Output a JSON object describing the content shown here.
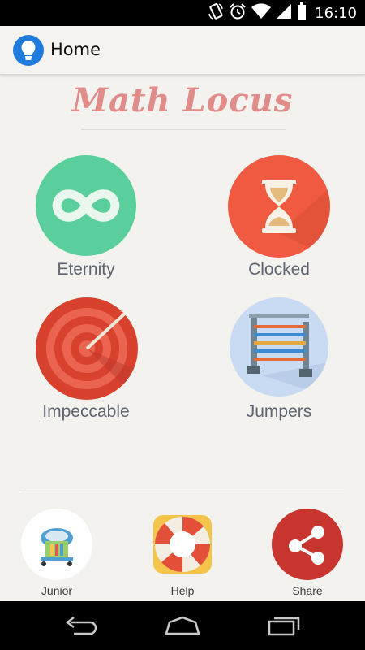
{
  "status_bar": {
    "time": "16:10",
    "icons": [
      "rotate-icon",
      "alarm-icon",
      "wifi-icon",
      "signal-icon",
      "battery-icon"
    ]
  },
  "action_bar": {
    "title": "Home",
    "logo_icon": "lightbulb-icon"
  },
  "app_title": "Math Locus",
  "modes": [
    {
      "label": "Eternity",
      "icon": "infinity-icon",
      "color": "#5bcf9b"
    },
    {
      "label": "Clocked",
      "icon": "hourglass-icon",
      "color": "#ef5a40"
    },
    {
      "label": "Impeccable",
      "icon": "target-icon",
      "color": "#d9412f"
    },
    {
      "label": "Jumpers",
      "icon": "hurdle-icon",
      "color": "#c9daf3"
    }
  ],
  "bottom_bar": [
    {
      "label": "Junior",
      "icon": "baby-walker-icon"
    },
    {
      "label": "Help",
      "icon": "lifebuoy-icon"
    },
    {
      "label": "Share",
      "icon": "share-icon"
    }
  ],
  "nav_bar": {
    "icons": [
      "back-icon",
      "home-icon",
      "recents-icon"
    ]
  },
  "colors": {
    "background": "#f3f2ee",
    "title": "#e08c8a",
    "logo": "#1f7bdc",
    "label": "#5e6470"
  }
}
